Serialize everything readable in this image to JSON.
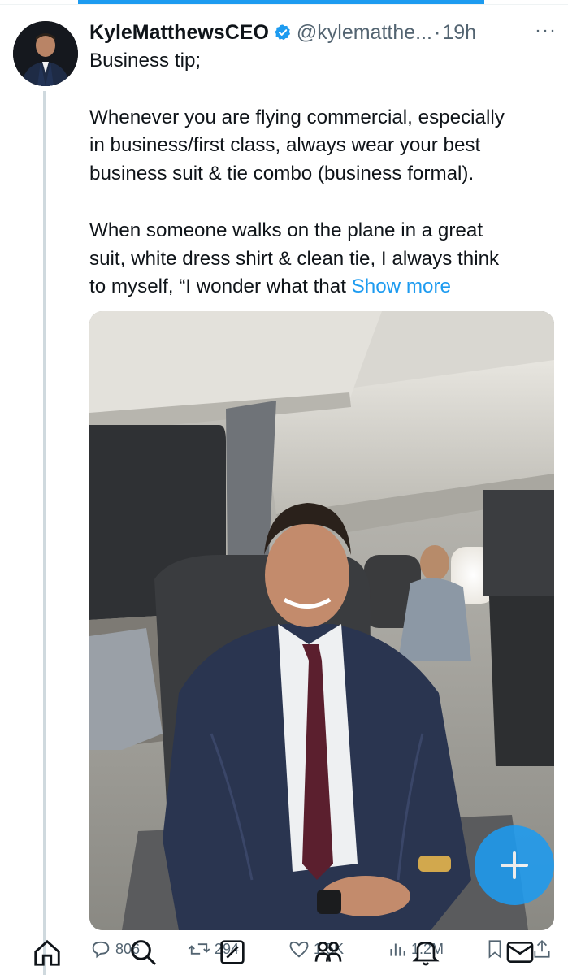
{
  "tweet": {
    "display_name": "KyleMatthewsCEO",
    "handle": "@kylematthe...",
    "separator": "·",
    "time": "19h",
    "more": "···",
    "lines_p1": [
      "Business tip;"
    ],
    "lines_p2": [
      "Whenever you are flying commercial, especially",
      "in business/first class, always wear your best",
      "business suit & tie combo (business formal)."
    ],
    "lines_p3": [
      "When someone walks on the plane in a great",
      "suit, white dress shirt & clean tie, I always think"
    ],
    "last_line": "to myself, “I wonder what that ",
    "show_more": "Show more"
  },
  "media": {
    "description_icon": "photo"
  },
  "actions": {
    "replies": "806",
    "reposts": "294",
    "likes": "1.5K",
    "views": "1.2M"
  },
  "icons": {
    "reply": "reply-icon",
    "repost": "repost-icon",
    "like": "heart-icon",
    "views": "views-icon",
    "bookmark": "bookmark-icon",
    "share": "share-icon",
    "home": "home-icon",
    "search": "search-icon",
    "communities": "communities-icon",
    "grok": "grok-icon",
    "messages": "messages-icon",
    "compose": "plus-icon"
  },
  "colors": {
    "accent": "#1d9bf0",
    "text": "#0f1419",
    "muted": "#536471"
  }
}
